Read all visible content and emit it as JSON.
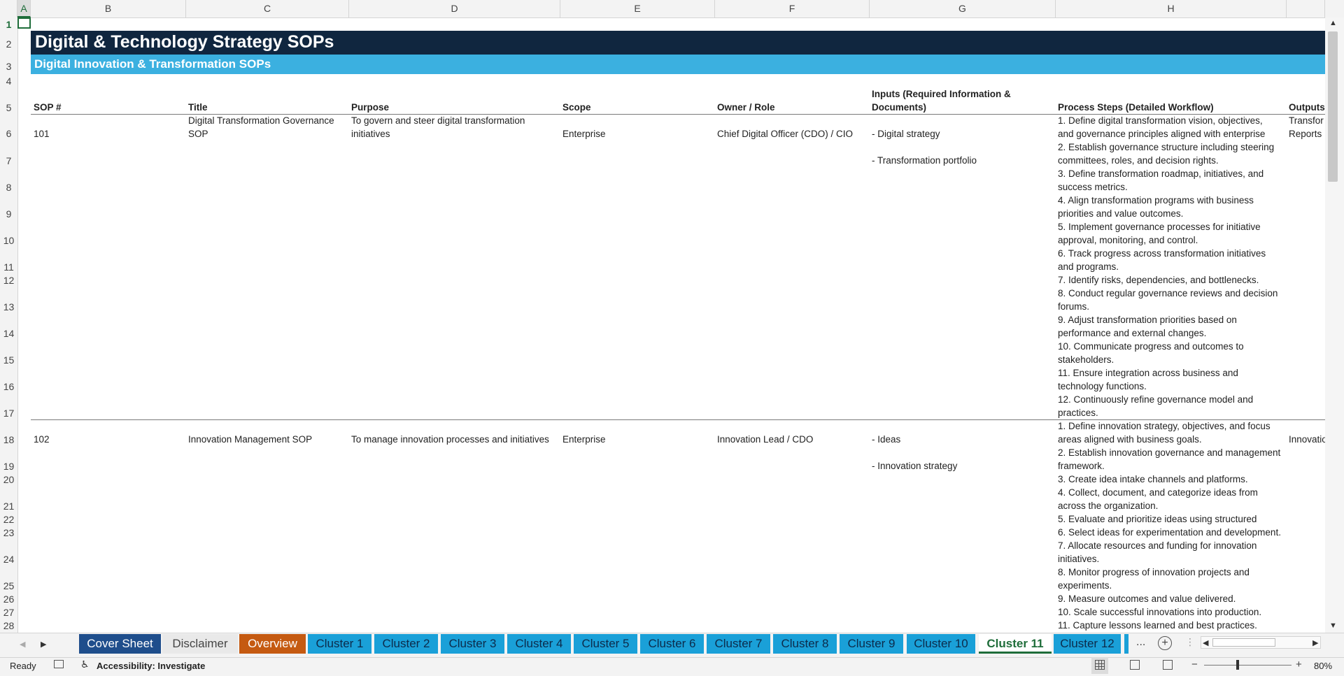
{
  "columns": [
    "A",
    "B",
    "C",
    "D",
    "E",
    "F",
    "G",
    "H"
  ],
  "rows": [
    "1",
    "2",
    "3",
    "4",
    "5",
    "6",
    "7",
    "8",
    "9",
    "10",
    "11",
    "12",
    "13",
    "14",
    "15",
    "16",
    "17",
    "18",
    "19",
    "20",
    "21",
    "22",
    "23",
    "24",
    "25",
    "26",
    "27",
    "28"
  ],
  "sheet": {
    "title": "Digital & Technology Strategy SOPs",
    "subtitle": "Digital Innovation & Transformation SOPs",
    "headers": {
      "sop": "SOP #",
      "title": "Title",
      "purpose": "Purpose",
      "scope": "Scope",
      "owner": "Owner / Role",
      "inputs_1": "Inputs (Required Information &",
      "inputs_2": "Documents)",
      "process": "Process Steps (Detailed Workflow)",
      "outputs": "Outputs"
    },
    "records": [
      {
        "sop": "101",
        "title_1": "Digital Transformation Governance",
        "title_2": "SOP",
        "purpose_1": "To govern and steer digital transformation",
        "purpose_2": "initiatives",
        "scope": "Enterprise",
        "owner": "Chief Digital Officer (CDO) / CIO",
        "inputs": [
          "- Digital strategy",
          "- Transformation portfolio"
        ],
        "outputs_1": "Transfor",
        "outputs_2": "Reports",
        "steps": [
          "1. Define digital transformation vision, objectives,",
          "and governance principles aligned with enterprise",
          "2. Establish governance structure including steering",
          "committees, roles, and decision rights.",
          "3. Define transformation roadmap, initiatives, and",
          "success metrics.",
          "4. Align transformation programs with business",
          "priorities and value outcomes.",
          "5. Implement governance processes for initiative",
          "approval, monitoring, and control.",
          "6. Track progress across transformation initiatives",
          "and programs.",
          "7. Identify risks, dependencies, and bottlenecks.",
          "8. Conduct regular governance reviews and decision",
          "forums.",
          "9. Adjust transformation priorities based on",
          "performance and external changes.",
          "10. Communicate progress and outcomes to",
          "stakeholders.",
          "11. Ensure integration across business and",
          "technology functions.",
          "12. Continuously refine governance model and",
          "practices."
        ]
      },
      {
        "sop": "102",
        "title_1": "Innovation Management SOP",
        "purpose_1": "To manage innovation processes and initiatives",
        "scope": "Enterprise",
        "owner": "Innovation Lead / CDO",
        "inputs": [
          "- Ideas",
          "- Innovation strategy"
        ],
        "outputs_1": "Innovatio",
        "steps": [
          "1. Define innovation strategy, objectives, and focus",
          "areas aligned with business goals.",
          "2. Establish innovation governance and management",
          "framework.",
          "3. Create idea intake channels and platforms.",
          "4. Collect, document, and categorize ideas from",
          "across the organization.",
          "5. Evaluate and prioritize ideas using structured",
          "6. Select ideas for experimentation and development.",
          "7. Allocate resources and funding for innovation",
          "initiatives.",
          "8. Monitor progress of innovation projects and",
          "experiments.",
          "9. Measure outcomes and value delivered.",
          "10. Scale successful innovations into production.",
          "11. Capture lessons learned and best practices."
        ]
      }
    ]
  },
  "tabs": {
    "cover": "Cover Sheet",
    "disclaimer": "Disclaimer",
    "overview": "Overview",
    "c1": "Cluster 1",
    "c2": "Cluster 2",
    "c3": "Cluster 3",
    "c4": "Cluster 4",
    "c5": "Cluster 5",
    "c6": "Cluster 6",
    "c7": "Cluster 7",
    "c8": "Cluster 8",
    "c9": "Cluster 9",
    "c10": "Cluster 10",
    "c11": "Cluster 11",
    "c12": "Cluster 12",
    "more": "...",
    "active": "Cluster 11"
  },
  "status": {
    "ready": "Ready",
    "accessibility": "Accessibility: Investigate",
    "zoom": "80%"
  },
  "colors": {
    "title_bg": "#10263f",
    "subtitle_bg": "#3bb0e0",
    "cluster_tab": "#1aa0d8",
    "cover_tab": "#1f4e8c",
    "overview_tab": "#c55a11",
    "accent": "#1f6d3a"
  }
}
